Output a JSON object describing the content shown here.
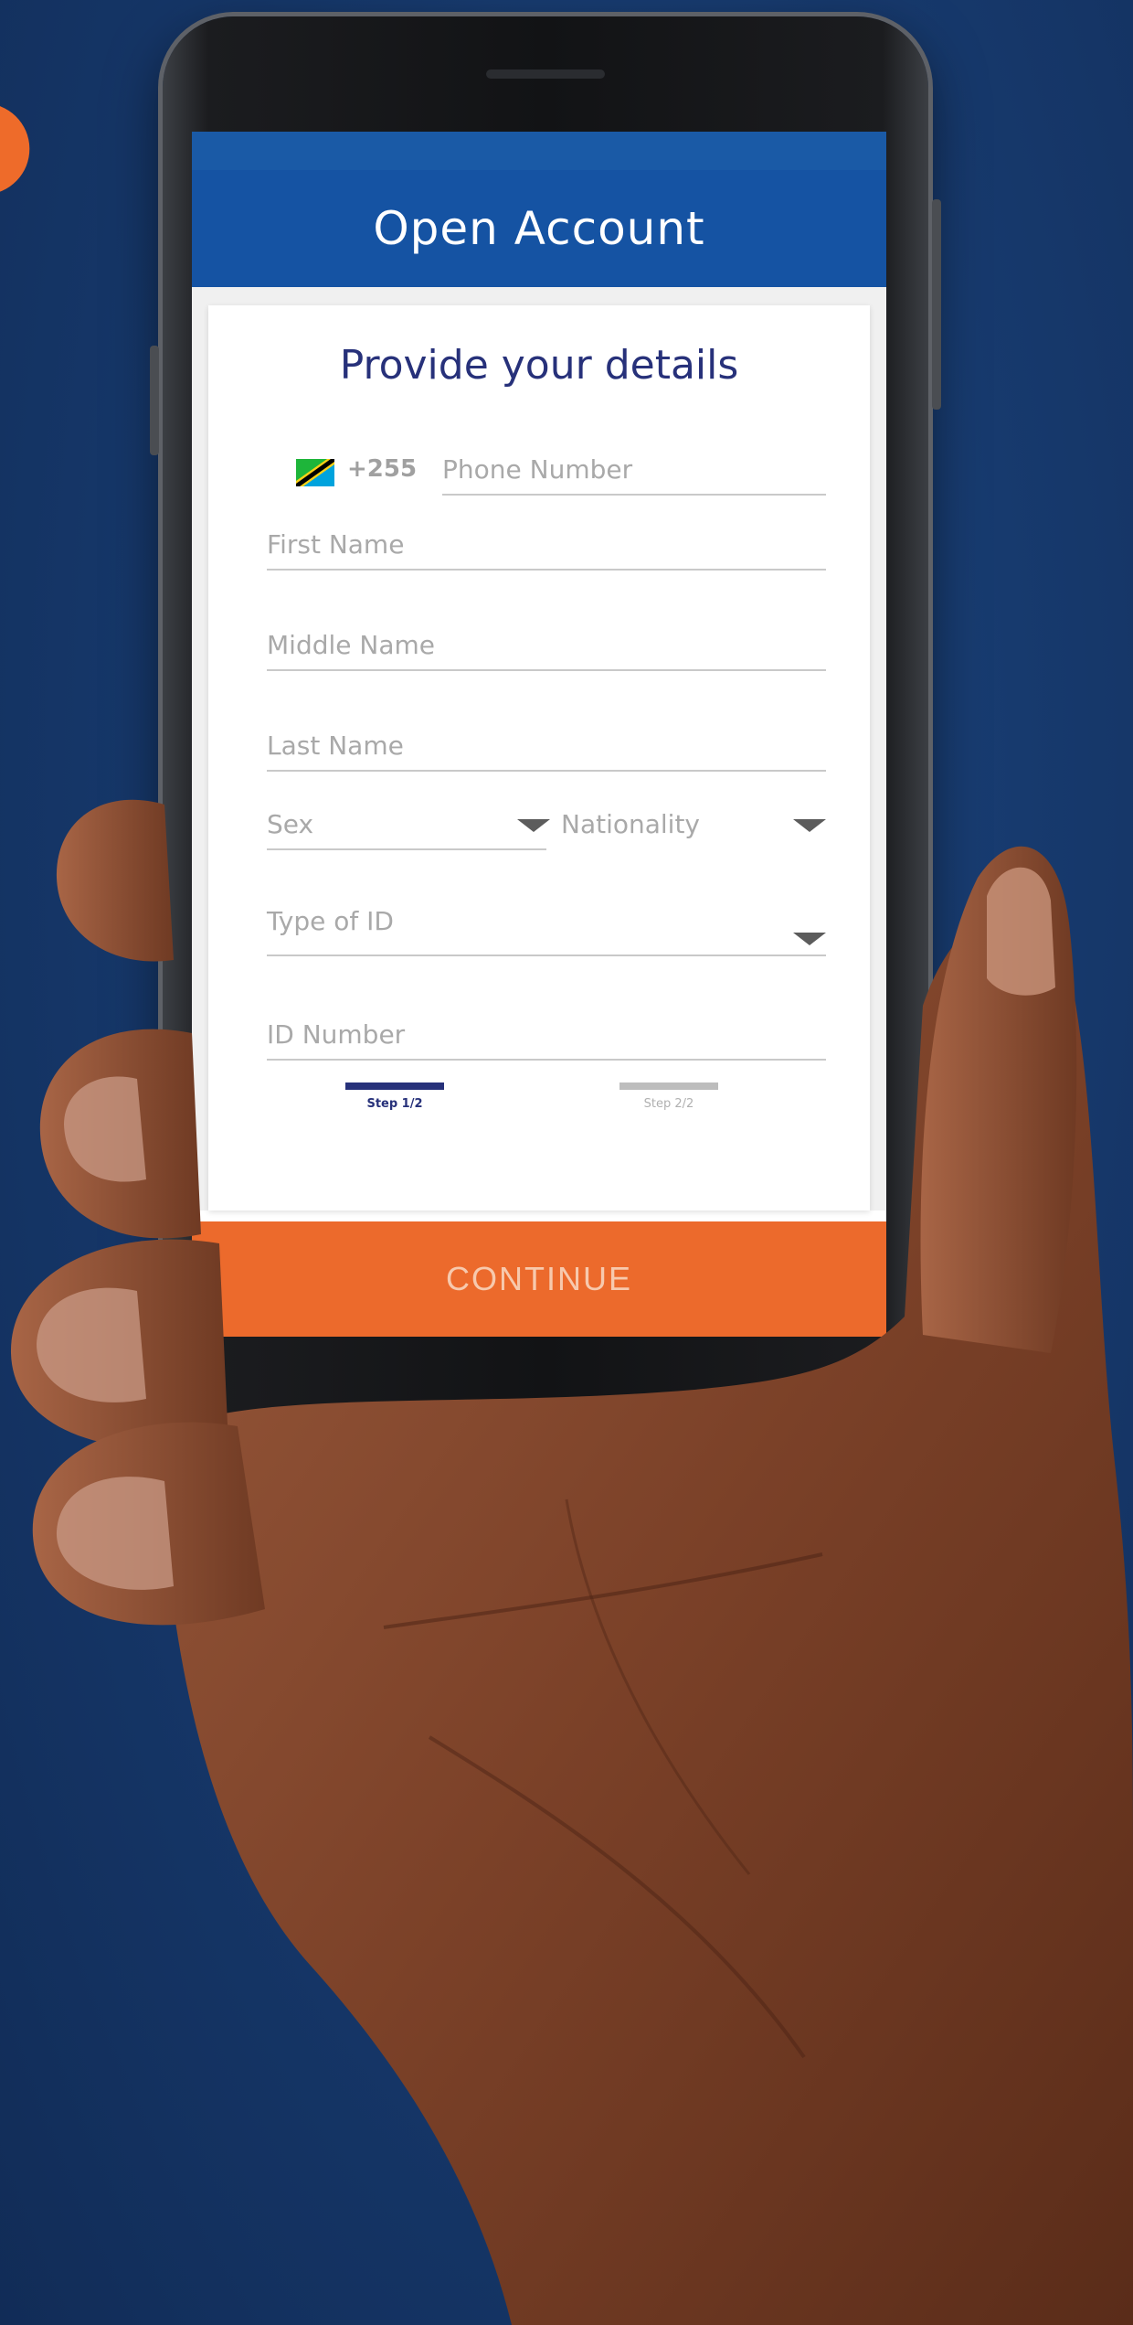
{
  "app_bar": {
    "title": "Open Account"
  },
  "form": {
    "title": "Provide your details",
    "country_code": "+255",
    "fields": {
      "phone": "Phone Number",
      "first_name": "First Name",
      "middle_name": "Middle Name",
      "last_name": "Last Name",
      "sex": "Sex",
      "nationality": "Nationality",
      "id_type": "Type of ID",
      "id_number": "ID Number"
    }
  },
  "steps": [
    {
      "label": "Step 1/2",
      "active": true
    },
    {
      "label": "Step 2/2",
      "active": false
    }
  ],
  "continue_label": "CONTINUE",
  "colors": {
    "app_bar": "#1553a3",
    "title_text": "#27317a",
    "continue_button": "#ec6a2c",
    "background": "#173a6e"
  },
  "icons": [
    "tanzania-flag-icon",
    "dropdown-caret-icon"
  ]
}
